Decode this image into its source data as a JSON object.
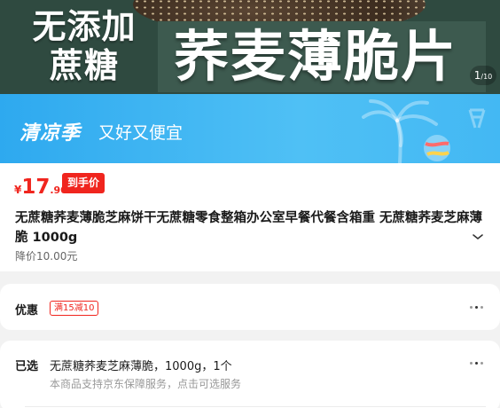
{
  "hero": {
    "left_line1": "无添加",
    "left_line2": "蔗糖",
    "title": "荞麦薄脆片",
    "counter_current": "1",
    "counter_total": "/10"
  },
  "promo": {
    "season": "清凉季",
    "slogan": "又好又便宜"
  },
  "price": {
    "currency": "¥",
    "integer": "17",
    "decimal": ".90",
    "tag": "到手价"
  },
  "product": {
    "title": "无蔗糖荞麦薄脆芝麻饼干无蔗糖零食整箱办公室早餐代餐含箱重 无蔗糖荞麦芝麻薄脆 1000g",
    "drop_price": "降价10.00元"
  },
  "coupon": {
    "label": "优惠",
    "tag": "满15减10"
  },
  "selected": {
    "label": "已选",
    "value": "无蔗糖荞麦芝麻薄脆，1000g，1个",
    "note": "本商品支持京东保障服务，点击可选服务"
  },
  "colors": {
    "accent_red": "#f0251e",
    "hero_green": "#2f4a40",
    "promo_blue": "#2ea9ef"
  },
  "icons": [
    "palm-tree-icon",
    "beach-ball-icon",
    "chevron-down-icon",
    "more-dots-icon"
  ]
}
